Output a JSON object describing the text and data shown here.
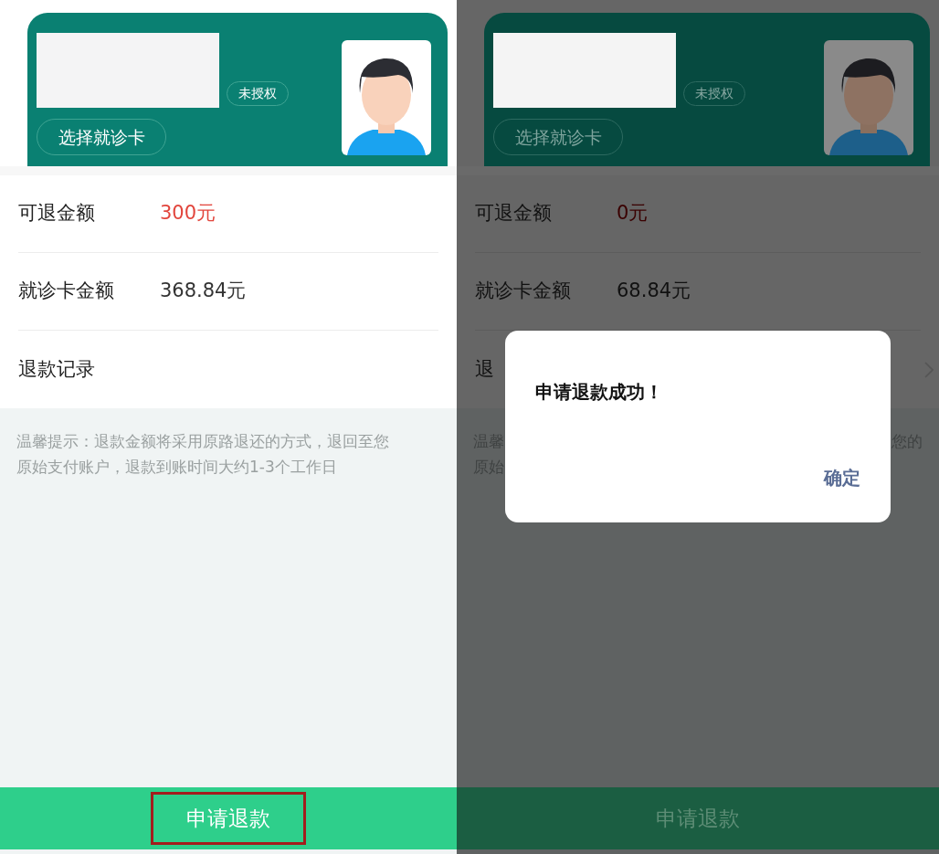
{
  "screens": [
    {
      "dimmed": false,
      "card": {
        "badge": "未授权",
        "select_button": "选择就诊卡"
      },
      "rows": [
        {
          "label": "可退金额",
          "value": "300元",
          "kind": "amount",
          "arrow": false
        },
        {
          "label": "就诊卡金额",
          "value": "368.84元",
          "kind": "plain",
          "arrow": false
        },
        {
          "label": "退款记录",
          "kind": "link",
          "arrow": false
        }
      ],
      "tip": {
        "lines": [
          "温馨提示：退款金额将采用原路退还的方式，退回至您",
          "原始支付账户，退款到账时间大约1-3个工作日"
        ]
      },
      "submit": {
        "label": "申请退款",
        "highlighted": true
      }
    },
    {
      "dimmed": true,
      "card": {
        "badge": "未授权",
        "select_button": "选择就诊卡"
      },
      "rows": [
        {
          "label": "可退金额",
          "value": "0元",
          "kind": "amount",
          "arrow": false
        },
        {
          "label": "就诊卡金额",
          "value": "68.84元",
          "kind": "plain",
          "arrow": false
        },
        {
          "label": "退",
          "kind": "link",
          "arrow": true
        }
      ],
      "tip": {
        "lines": [
          "温馨",
          "原始"
        ],
        "tail": "您的"
      },
      "submit": {
        "label": "申请退款",
        "highlighted": false
      },
      "dialog": {
        "message": "申请退款成功！",
        "confirm": "确定"
      }
    }
  ]
}
